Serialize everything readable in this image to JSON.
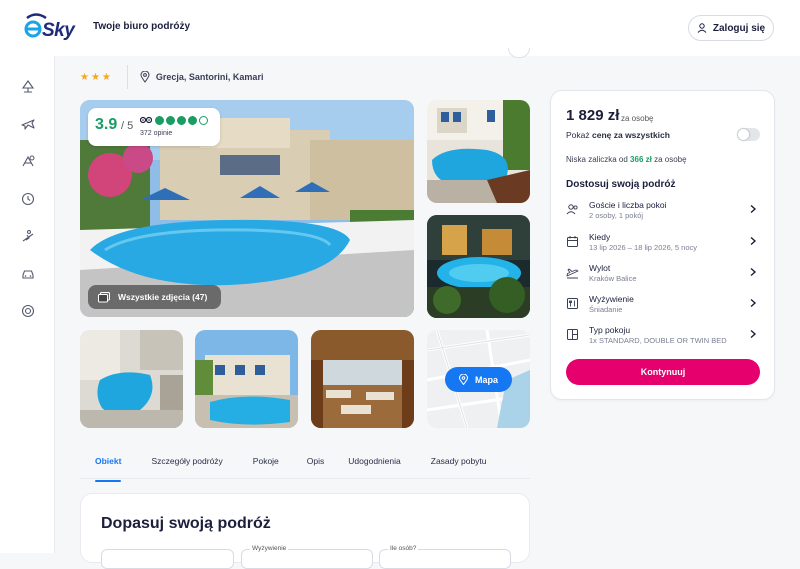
{
  "header": {
    "logo_text": "eSky",
    "tagline": "Twoje biuro podróży",
    "login_label": "Zaloguj się",
    "brand_color": "#1e2a7a",
    "accent_color": "#1aa3e8"
  },
  "sidenav": {
    "items": [
      {
        "icon": "beach-icon"
      },
      {
        "icon": "plane-icon"
      },
      {
        "icon": "plane-hotel-icon"
      },
      {
        "icon": "clock-icon"
      },
      {
        "icon": "ski-icon"
      },
      {
        "icon": "car-icon"
      },
      {
        "icon": "lifebuoy-icon"
      }
    ]
  },
  "hotel": {
    "stars": "★★★",
    "star_count": 3,
    "location": "Grecja, Santorini, Kamari"
  },
  "gallery": {
    "rating": "3.9",
    "rating_max": "/ 5",
    "rating_dots_filled": 4,
    "rating_dots_total": 5,
    "opinions": "372 opinie",
    "all_photos_label": "Wszystkie zdjęcia (47)",
    "map_label": "Mapa"
  },
  "tabs": [
    {
      "label": "Obiekt",
      "active": true
    },
    {
      "label": "Szczegóły podróży",
      "active": false
    },
    {
      "label": "Pokoje",
      "active": false
    },
    {
      "label": "Opis",
      "active": false
    },
    {
      "label": "Udogodnienia",
      "active": false
    },
    {
      "label": "Zasady pobytu",
      "active": false
    }
  ],
  "bottom": {
    "title": "Dopasuj swoją podróż",
    "field_meal_label": "Wyżywienie",
    "field_people_label": "Ile osób?"
  },
  "booking": {
    "price": "1 829 zł",
    "price_unit": "za osobę",
    "toggle_prefix": "Pokaż",
    "toggle_bold": "cenę za wszystkich",
    "toggle_on": false,
    "deposit_prefix": "Niska zaliczka od",
    "deposit_amount": "366 zł",
    "deposit_suffix": "za osobę",
    "customize_title": "Dostosuj swoją podróż",
    "options": [
      {
        "icon": "guests-icon",
        "title": "Goście i liczba pokoi",
        "value": "2 osoby, 1 pokój"
      },
      {
        "icon": "calendar-icon",
        "title": "Kiedy",
        "value": "13 lip 2026 – 18 lip 2026, 5 nocy"
      },
      {
        "icon": "plane-takeoff-icon",
        "title": "Wylot",
        "value": "Kraków Balice"
      },
      {
        "icon": "meal-icon",
        "title": "Wyżywienie",
        "value": "Śniadanie"
      },
      {
        "icon": "room-icon",
        "title": "Typ pokoju",
        "value": "1x STANDARD, DOUBLE OR TWIN BED"
      }
    ],
    "cta_label": "Kontynuuj",
    "cta_color": "#e5006d"
  }
}
